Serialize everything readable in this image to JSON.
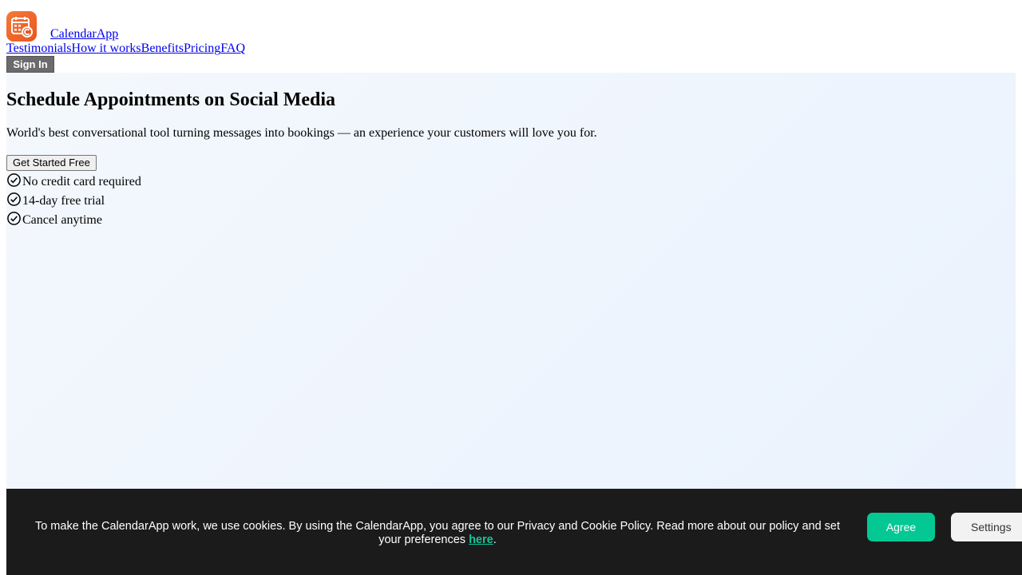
{
  "header": {
    "brand_name": "CalendarApp",
    "logo_icon": "calendar-app-logo-icon",
    "nav": [
      {
        "label": "Testimonials"
      },
      {
        "label": "How it works"
      },
      {
        "label": "Benefits"
      },
      {
        "label": "Pricing"
      },
      {
        "label": "FAQ"
      }
    ],
    "signin_label": "Sign In"
  },
  "hero": {
    "title": "Schedule Appointments on Social Media",
    "subtitle": "World's best conversational tool turning messages into bookings — an experience your customers will love you for.",
    "cta_label": "Get Started Free",
    "checks": [
      {
        "label": "No credit card required",
        "icon": "check-circle-icon"
      },
      {
        "label": "14-day free trial",
        "icon": "check-circle-icon"
      },
      {
        "label": "Cancel anytime",
        "icon": "check-circle-icon"
      }
    ]
  },
  "cookie": {
    "text_before": "To make the CalendarApp work, we use cookies. By using the CalendarApp, you agree to our Privacy and Cookie Policy. Read more about our policy and set your preferences ",
    "link_label": "here",
    "text_after": ".",
    "agree_label": "Agree",
    "settings_label": "Settings"
  },
  "colors": {
    "accent_green": "#03c894",
    "logo_orange": "#f47a3a",
    "cookie_bg": "#1b1b1b"
  }
}
